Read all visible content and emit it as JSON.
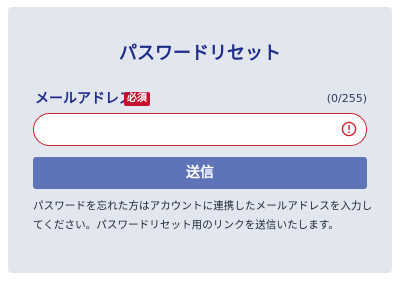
{
  "page": {
    "title": "パスワードリセット"
  },
  "form": {
    "email_label": "メールアドレス",
    "required_badge": "必須",
    "char_count": "(0/255)",
    "email_value": "",
    "email_placeholder": "",
    "error_icon": "exclamation-circle-icon",
    "submit_label": "送信",
    "help_text": "パスワードを忘れた方はアカウントに連携したメールアドレスを入力してください。パスワードリセット用のリンクを送信いたします。"
  },
  "colors": {
    "card_background": "#e2e6ef",
    "title": "#1f2d8a",
    "required_badge": "#c8102e",
    "input_error_border": "#d0202a",
    "submit_button": "#5f73b8"
  }
}
